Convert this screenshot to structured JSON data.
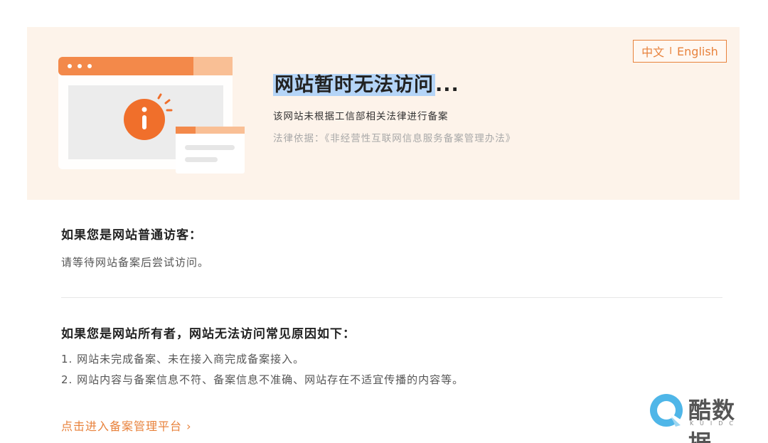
{
  "lang_switch": {
    "zh": "中文",
    "separator": "I",
    "en": "English"
  },
  "hero": {
    "title_highlight": "网站暂时无法访问",
    "title_suffix": "...",
    "subtitle": "该网站未根据工信部相关法律进行备案",
    "law": "法律依据：《非经营性互联网信息服务备案管理办法》"
  },
  "visitor": {
    "title": "如果您是网站普通访客：",
    "text": "请等待网站备案后尝试访问。"
  },
  "owner": {
    "title": "如果您是网站所有者，网站无法访问常见原因如下：",
    "reasons": [
      "1. 网站未完成备案、未在接入商完成备案接入。",
      "2. 网站内容与备案信息不符、备案信息不准确、网站存在不适宜传播的内容等。"
    ]
  },
  "link": {
    "label": "点击进入备案管理平台 ›"
  },
  "watermark": {
    "brand": "酷数据",
    "sub": "KUIDC"
  },
  "colors": {
    "accent": "#e8823c",
    "hero_bg": "#fdf3ea",
    "highlight": "#b4d4f7"
  }
}
